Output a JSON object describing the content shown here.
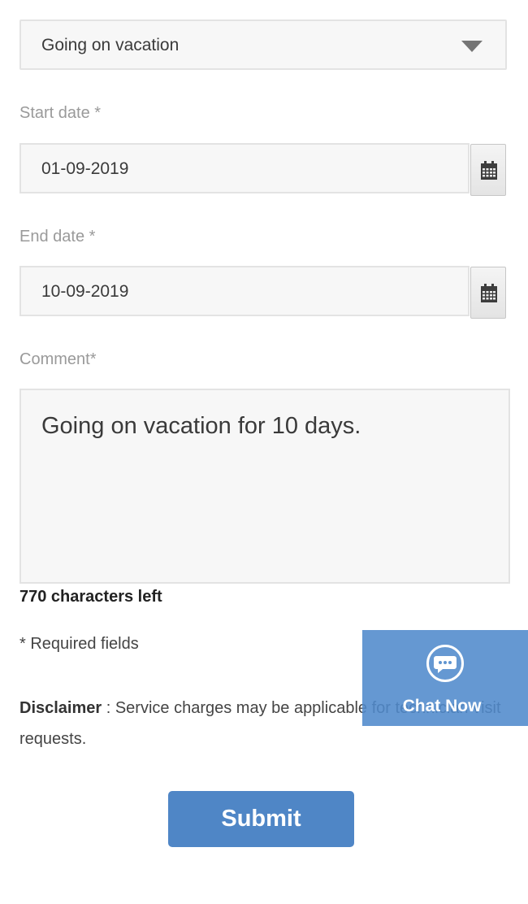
{
  "reason_select": {
    "value": "Going on vacation"
  },
  "start_date": {
    "label": "Start date *",
    "value": "01-09-2019"
  },
  "end_date": {
    "label": "End date *",
    "value": "10-09-2019"
  },
  "comment": {
    "label": "Comment*",
    "value": "Going on vacation for 10 days.",
    "chars_left": "770 characters left"
  },
  "required_note": "* Required fields",
  "disclaimer": {
    "heading": "Disclaimer",
    "text": " : Service charges may be applicable for technician visit requests."
  },
  "chat": {
    "label": "Chat Now"
  },
  "submit": {
    "label": "Submit"
  },
  "icons": {
    "select_caret": "chevron-down-icon",
    "calendar": "calendar-icon",
    "chat": "chat-bubble-icon"
  },
  "colors": {
    "accent_blue": "#4f86c6",
    "chat_blue": "#508acc",
    "field_bg": "#f7f7f7",
    "label_gray": "#9a9a9a"
  }
}
